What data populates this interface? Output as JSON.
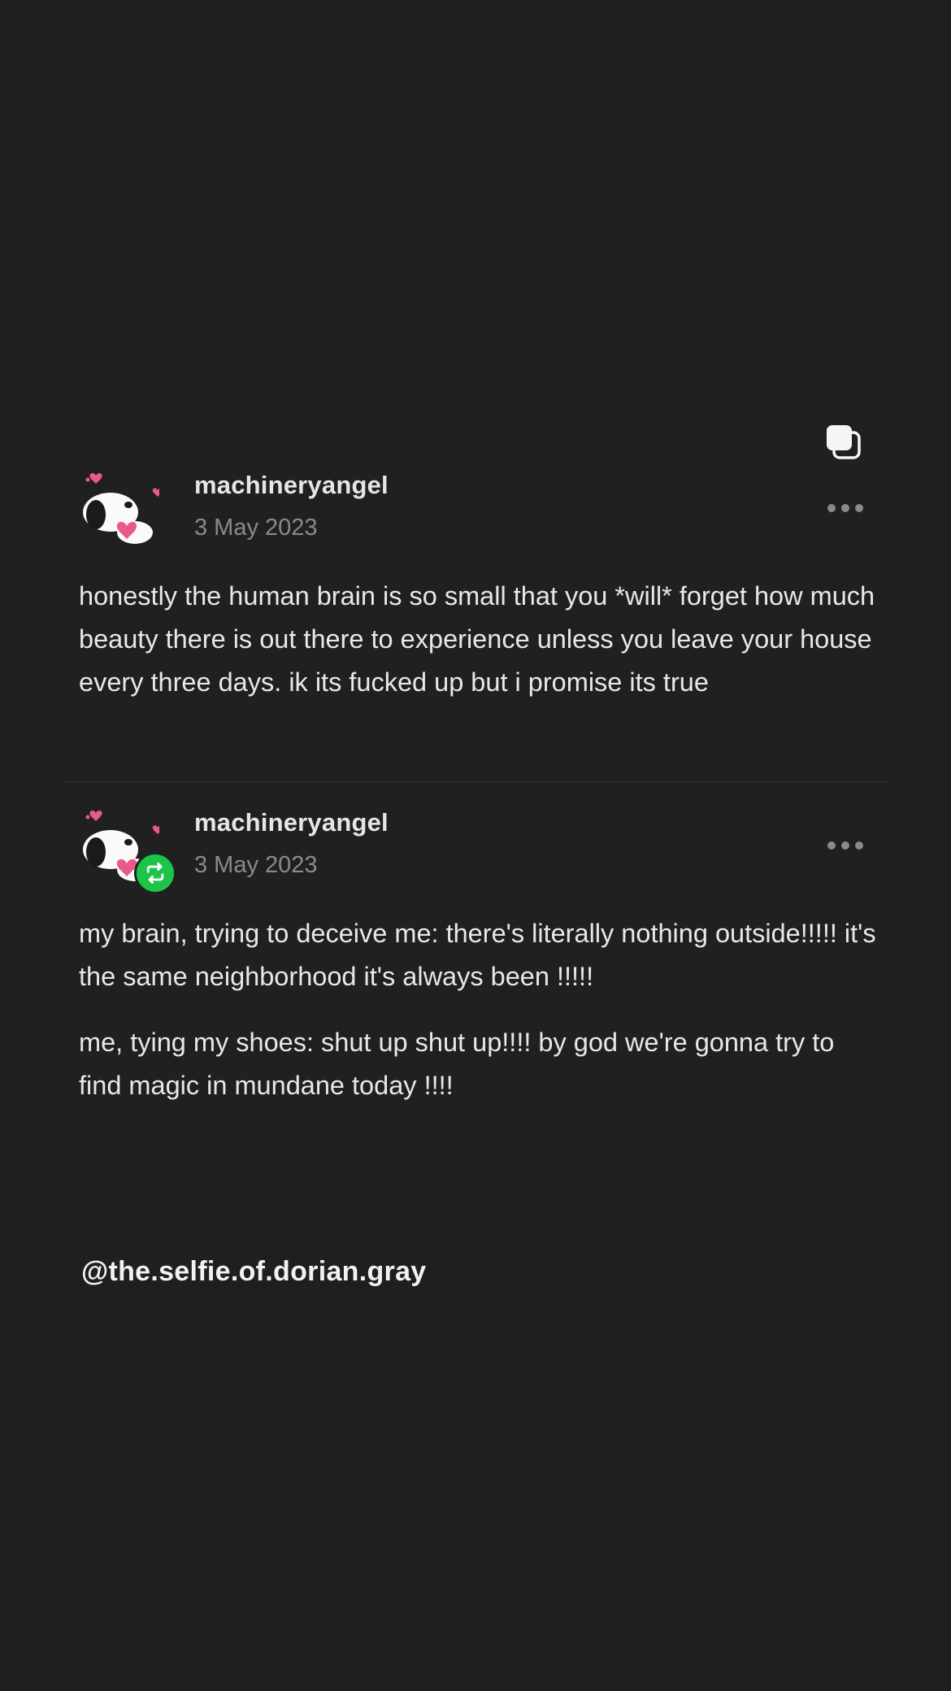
{
  "icons": {
    "multi_post": "stacked-squares-icon",
    "more": "more-dots-icon",
    "reblog": "reblog-arrows-icon",
    "avatar": "snoopy-hearts-avatar"
  },
  "colors": {
    "background": "#1f1f1f",
    "card": "#202020",
    "reblog_green": "#1cc44a",
    "heart_pink": "#e75a8b"
  },
  "posts": [
    {
      "username": "machineryangel",
      "date": "3 May 2023",
      "paragraphs": [
        "honestly the human brain is so small that you *will* forget how much beauty there is out there to experience unless you leave your house every three days. ik its fucked up but i promise its true"
      ]
    },
    {
      "username": "machineryangel",
      "date": "3 May 2023",
      "reblogged": true,
      "paragraphs": [
        "my brain, trying to deceive me: there's literally nothing outside!!!!! it's the same neighborhood it's always been !!!!!",
        "me, tying my shoes: shut up shut up!!!! by god we're gonna try to find magic in mundane today !!!!"
      ]
    }
  ],
  "credit": "@the.selfie.of.dorian.gray"
}
